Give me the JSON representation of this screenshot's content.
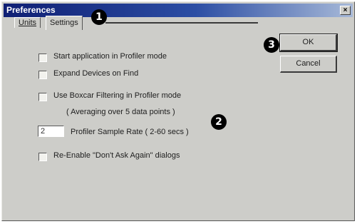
{
  "window": {
    "title": "Preferences",
    "close_glyph": "×"
  },
  "tabs": {
    "units": "Units",
    "settings": "Settings"
  },
  "buttons": {
    "ok": "OK",
    "cancel": "Cancel"
  },
  "options": [
    {
      "label": "Start application in Profiler mode",
      "checked": false
    },
    {
      "label": "Expand Devices on Find",
      "checked": false
    },
    {
      "label": "Use Boxcar Filtering in Profiler mode",
      "checked": false
    },
    {
      "label": "Re-Enable \"Don't Ask Again\" dialogs",
      "checked": false
    }
  ],
  "boxcar_note": "( Averaging over 5 data points )",
  "sample_rate": {
    "value": "2",
    "label": "Profiler Sample Rate ( 2-60 secs )"
  },
  "callouts": [
    "1",
    "2",
    "3"
  ]
}
